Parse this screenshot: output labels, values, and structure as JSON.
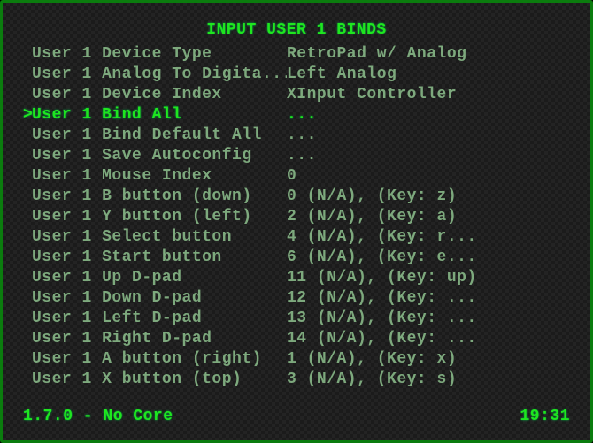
{
  "title": "INPUT USER 1 BINDS",
  "selected_index": 3,
  "items": [
    {
      "label": "User 1 Device Type",
      "value": "RetroPad w/ Analog"
    },
    {
      "label": "User 1 Analog To Digita...",
      "value": "Left Analog"
    },
    {
      "label": "User 1 Device Index",
      "value": "XInput Controller"
    },
    {
      "label": "User 1 Bind All",
      "value": "..."
    },
    {
      "label": "User 1 Bind Default All",
      "value": "..."
    },
    {
      "label": "User 1 Save Autoconfig",
      "value": "..."
    },
    {
      "label": "User 1 Mouse Index",
      "value": "0"
    },
    {
      "label": "User 1 B button (down)",
      "value": "0 (N/A), (Key: z)"
    },
    {
      "label": "User 1 Y button (left)",
      "value": "2 (N/A), (Key: a)"
    },
    {
      "label": "User 1 Select button",
      "value": "4 (N/A), (Key: r..."
    },
    {
      "label": "User 1 Start button",
      "value": "6 (N/A), (Key: e..."
    },
    {
      "label": "User 1 Up D-pad",
      "value": "11 (N/A), (Key: up)"
    },
    {
      "label": "User 1 Down D-pad",
      "value": "12 (N/A), (Key: ..."
    },
    {
      "label": "User 1 Left D-pad",
      "value": "13 (N/A), (Key: ..."
    },
    {
      "label": "User 1 Right D-pad",
      "value": "14 (N/A), (Key: ..."
    },
    {
      "label": "User 1 A button (right)",
      "value": "1 (N/A), (Key: x)"
    },
    {
      "label": "User 1 X button (top)",
      "value": "3 (N/A), (Key: s)"
    }
  ],
  "footer": {
    "version": "1.7.0 - No Core",
    "clock": "19:31"
  }
}
